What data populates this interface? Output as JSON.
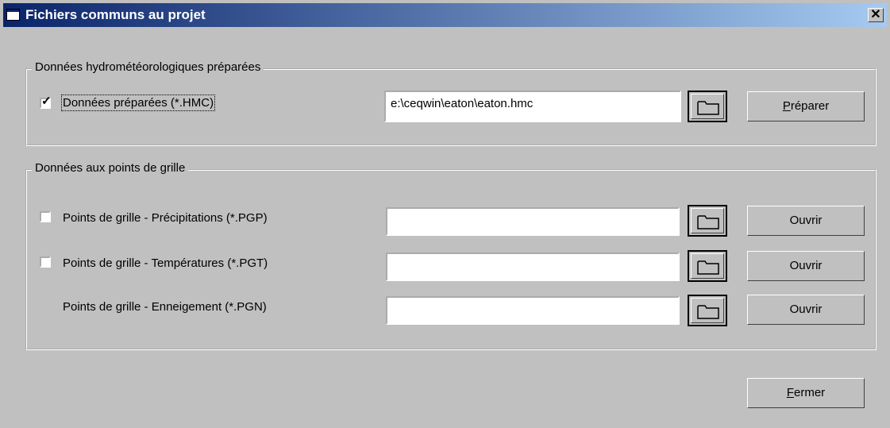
{
  "window": {
    "title": "Fichiers communs au projet",
    "close_label": "✕"
  },
  "group1": {
    "legend": "Données hydrométéorologiques préparées",
    "checkbox_checked": true,
    "checkbox_label": "Données préparées (*.HMC)",
    "path_value": "e:\\ceqwin\\eaton\\eaton.hmc",
    "button_mnemonic": "P",
    "button_rest": "réparer"
  },
  "group2": {
    "legend": "Données aux points de grille",
    "rows": [
      {
        "checkbox": true,
        "label": "Points de grille - Précipitations  (*.PGP)",
        "value": "",
        "button": "Ouvrir"
      },
      {
        "checkbox": true,
        "label": "Points de grille - Températures (*.PGT)",
        "value": "",
        "button": "Ouvrir"
      },
      {
        "checkbox": false,
        "label": "Points de grille - Enneigement (*.PGN)",
        "value": "",
        "button": "Ouvrir"
      }
    ]
  },
  "footer": {
    "close_mnemonic": "F",
    "close_rest": "ermer"
  }
}
